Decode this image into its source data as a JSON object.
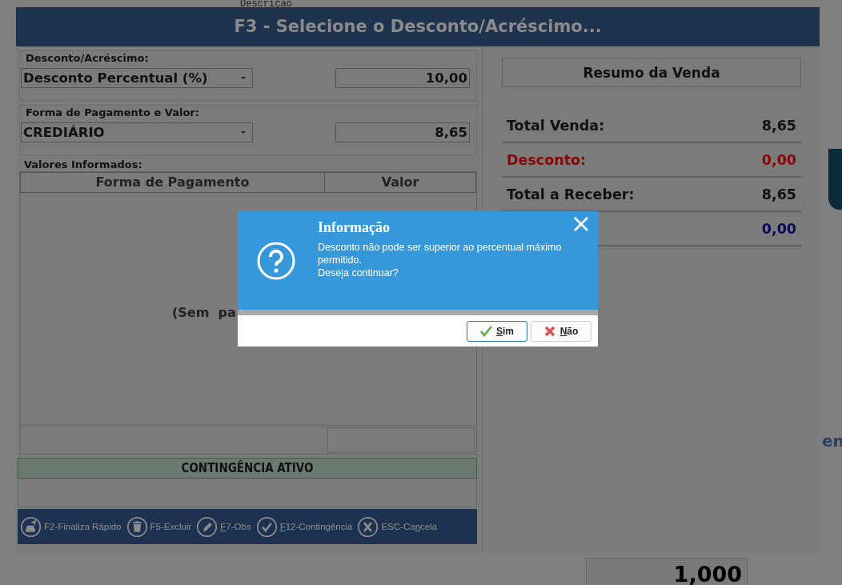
{
  "background": {
    "column_heading": "Descrição",
    "side_text": "en",
    "quantity_value": "1,000"
  },
  "window": {
    "title": "F3 - Selecione o Desconto/Acréscimo..."
  },
  "discount_group": {
    "label": "Desconto/Acréscimo:",
    "type_value": "Desconto Percentual (%)",
    "amount": "10,00"
  },
  "payment_group": {
    "label": "Forma de Pagamento e Valor:",
    "method_value": "CREDIÁRIO",
    "amount": "8,65"
  },
  "payments_table": {
    "label": "Valores Informados:",
    "columns": [
      "Forma de Pagamento",
      "Valor"
    ],
    "empty_text": "(Sem  pa"
  },
  "contingency_banner": "CONTINGÊNCIA ATIVO",
  "shortcuts": [
    {
      "label": "F2-Finaliza Rápido",
      "kind": "finalize"
    },
    {
      "label": "F5-Excluir",
      "kind": "delete"
    },
    {
      "label": [
        {
          "text": "F",
          "underlined": true
        },
        {
          "text": "7-Obs",
          "underlined": false
        }
      ],
      "kind": "notes"
    },
    {
      "label": [
        {
          "text": "F",
          "underlined": true
        },
        {
          "text": "12-Contingência",
          "underlined": false
        }
      ],
      "kind": "confirm"
    },
    {
      "label": [
        {
          "text": "ESC-Ca",
          "underlined": false
        },
        {
          "text": "n",
          "underlined": true
        },
        {
          "text": "cela",
          "underlined": false
        }
      ],
      "kind": "cancel"
    }
  ],
  "summary": {
    "title": "Resumo da Venda",
    "rows": [
      {
        "label": "Total Venda:",
        "value": "8,65",
        "color": "#111111"
      },
      {
        "label": "Desconto:",
        "value": "0,00",
        "color": "#8a0505"
      },
      {
        "label": "Total a Receber:",
        "value": "8,65",
        "color": "#111111"
      },
      {
        "value": "0,00",
        "color": "#0a0a5c"
      }
    ]
  },
  "message_dialog": {
    "title": "Informação",
    "message": "Desconto não pode ser superior ao percentual máximo permitido.\nDeseja continuar?",
    "buttons": [
      {
        "label": [
          {
            "text": "S",
            "underlined": true
          },
          {
            "text": "im",
            "underlined": false
          }
        ],
        "kind": "confirm",
        "focused": true
      },
      {
        "label": [
          {
            "text": "N",
            "underlined": true
          },
          {
            "text": "ão",
            "underlined": false
          }
        ],
        "kind": "cancel",
        "focused": false
      }
    ]
  }
}
